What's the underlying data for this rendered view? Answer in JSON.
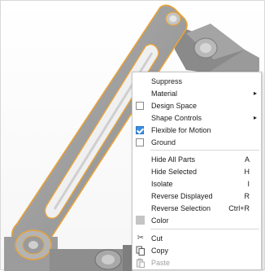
{
  "context_menu": {
    "items": [
      {
        "label": "Suppress",
        "has_submenu": false
      },
      {
        "label": "Material",
        "has_submenu": true
      },
      {
        "label": "Design Space",
        "checked": false
      },
      {
        "label": "Shape Controls",
        "has_submenu": true
      },
      {
        "label": "Flexible for Motion",
        "checked": true
      },
      {
        "label": "Ground",
        "checked": false
      },
      {
        "label": "Hide All Parts",
        "shortcut": "A"
      },
      {
        "label": "Hide Selected",
        "shortcut": "H"
      },
      {
        "label": "Isolate",
        "shortcut": "I"
      },
      {
        "label": "Reverse Displayed",
        "shortcut": "R"
      },
      {
        "label": "Reverse Selection",
        "shortcut": "Ctrl+R"
      },
      {
        "label": "Color",
        "swatch_color": "#c4c4c4"
      },
      {
        "label": "Cut",
        "icon": "scissors-icon"
      },
      {
        "label": "Copy",
        "icon": "copy-icon"
      },
      {
        "label": "Paste",
        "icon": "paste-icon",
        "disabled": true
      }
    ]
  },
  "colors": {
    "selection_outline": "#e8a33a",
    "part_fill": "#9a9a9a",
    "checkbox_checked": "#3c8ee0"
  }
}
